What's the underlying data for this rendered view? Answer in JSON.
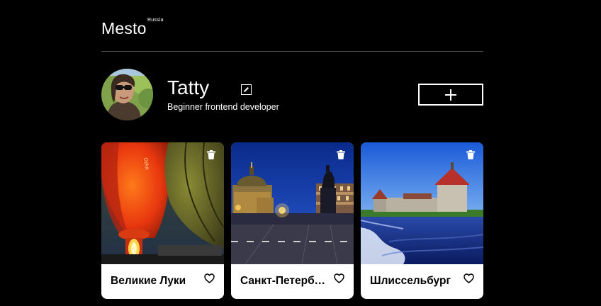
{
  "header": {
    "logo": "Mesto",
    "logo_sup": "Russia"
  },
  "profile": {
    "name": "Tatty",
    "about": "Beginner frontend developer",
    "edit_icon": "pencil-icon",
    "add_icon": "plus-icon"
  },
  "cards": [
    {
      "title": "Великие Луки",
      "photo": "hot-air-balloons"
    },
    {
      "title": "Санкт-Петербург",
      "photo": "st-petersburg-night"
    },
    {
      "title": "Шлиссельбург",
      "photo": "fortress-by-water"
    }
  ],
  "colors": {
    "background": "#000000",
    "text": "#ffffff",
    "card_background": "#ffffff",
    "divider": "#545454"
  }
}
